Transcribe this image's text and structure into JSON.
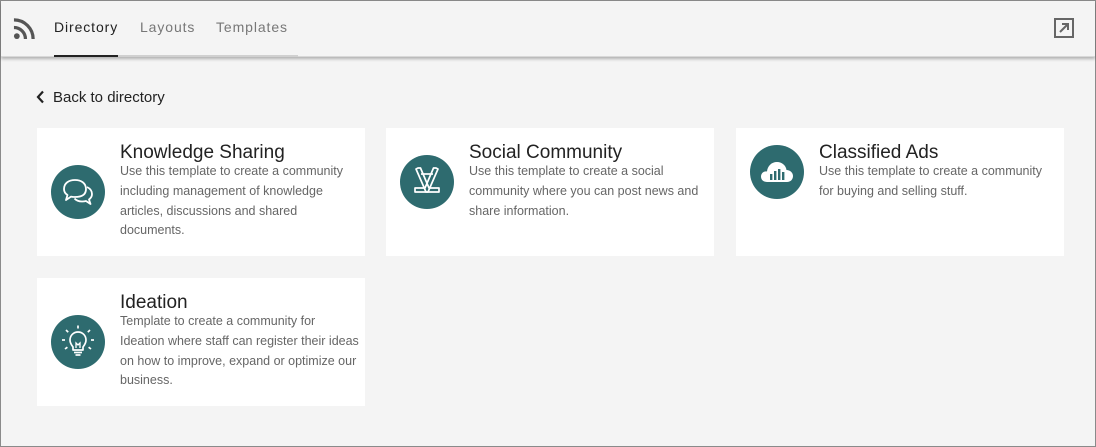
{
  "nav": {
    "tabs": [
      {
        "label": "Directory",
        "active": true
      },
      {
        "label": "Layouts",
        "active": false
      },
      {
        "label": "Templates",
        "active": false
      }
    ],
    "left_icon": "rss-feed-icon",
    "right_icon": "open-external-icon"
  },
  "back_link": {
    "label": "Back to directory",
    "icon": "chevron-left-icon"
  },
  "accent_color": "#2e6b6f",
  "cards": [
    {
      "title": "Knowledge Sharing",
      "description": "Use this template to create a community including management of knowledge articles, discussions and shared documents.",
      "icon": "chat-bubbles-icon"
    },
    {
      "title": "Social Community",
      "description": "Use this template to create a social community where you can post news and share information.",
      "icon": "hockey-sticks-icon"
    },
    {
      "title": "Classified Ads",
      "description": "Use this template to create a community for buying and selling stuff.",
      "icon": "cloud-chart-icon"
    },
    {
      "title": "Ideation",
      "description": "Template to create a community for Ideation where staff can register their ideas on how to improve, expand or optimize our business.",
      "icon": "lightbulb-icon"
    }
  ]
}
